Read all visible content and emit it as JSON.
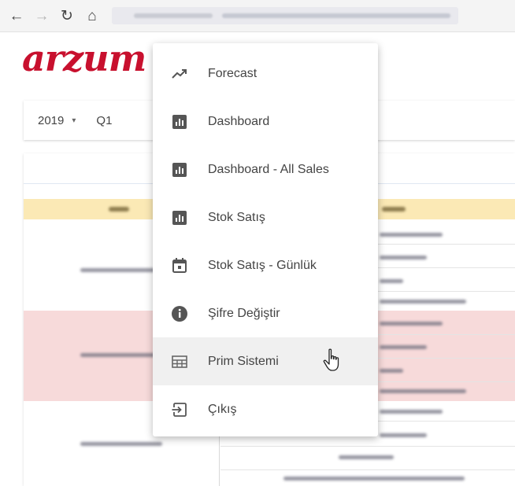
{
  "browser": {
    "back_icon": "←",
    "forward_icon": "→",
    "reload_icon": "↻",
    "home_icon": "⌂"
  },
  "header": {
    "logo_text": "arzum"
  },
  "filters": {
    "year": "2019",
    "year_arrow": "▾",
    "quarter": "Q1"
  },
  "menu": {
    "items": [
      {
        "label": "Forecast",
        "icon": "trend-line-icon"
      },
      {
        "label": "Dashboard",
        "icon": "bar-chart-icon"
      },
      {
        "label": "Dashboard - All Sales",
        "icon": "bar-chart-icon"
      },
      {
        "label": "Stok Satış",
        "icon": "bar-chart-icon"
      },
      {
        "label": "Stok Satış - Günlük",
        "icon": "calendar-icon"
      },
      {
        "label": "Şifre Değiştir",
        "icon": "info-icon"
      },
      {
        "label": "Prim Sistemi",
        "icon": "table-icon",
        "hovered": true
      },
      {
        "label": "Çıkış",
        "icon": "exit-icon"
      }
    ]
  },
  "colors": {
    "brand": "#c8102e",
    "table_header": "#fbe9b5",
    "row_highlight": "#f7dada",
    "menu_hover": "#f0f0f0"
  }
}
